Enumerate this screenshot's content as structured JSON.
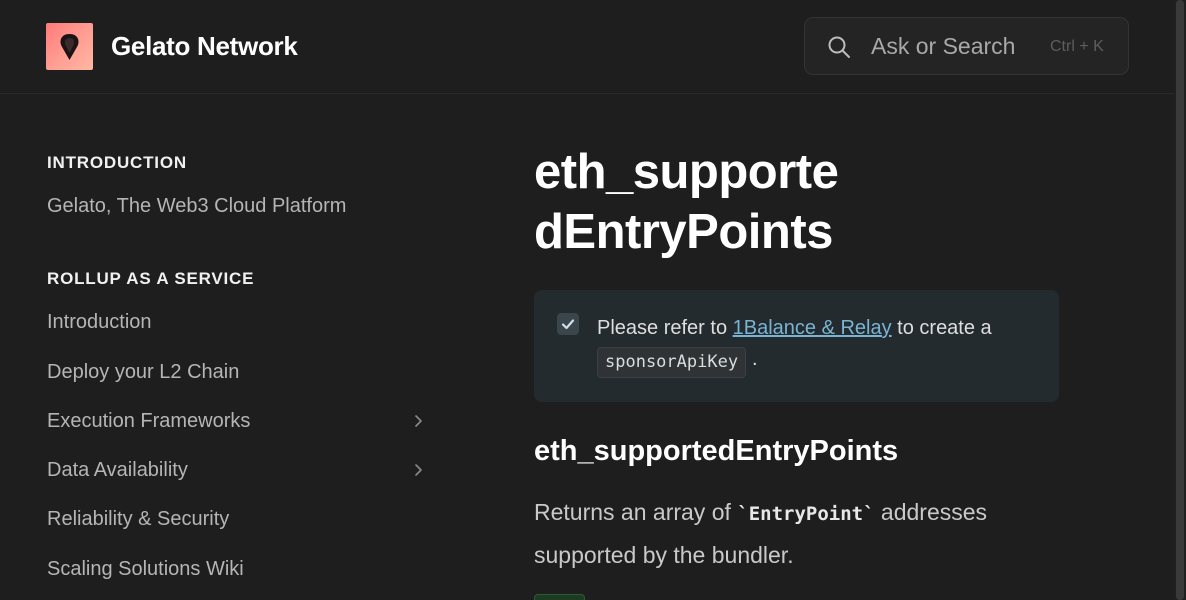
{
  "header": {
    "brand": "Gelato Network",
    "logo_icon": "gelato-logo",
    "search": {
      "placeholder": "Ask or Search",
      "shortcut": "Ctrl + K",
      "icon": "search-icon"
    }
  },
  "sidebar": {
    "sections": [
      {
        "title": "INTRODUCTION",
        "items": [
          {
            "label": "Gelato, The Web3 Cloud Platform"
          }
        ]
      },
      {
        "title": "ROLLUP AS A SERVICE",
        "items": [
          {
            "label": "Introduction"
          },
          {
            "label": "Deploy your L2 Chain"
          },
          {
            "label": "Execution Frameworks",
            "expandable": true
          },
          {
            "label": "Data Availability",
            "expandable": true
          },
          {
            "label": "Reliability & Security"
          },
          {
            "label": "Scaling Solutions Wiki"
          }
        ]
      }
    ]
  },
  "main": {
    "title": "eth_supportedEntryPoints",
    "title_line1": "eth_supporte",
    "title_line2": "dEntryPoints",
    "callout": {
      "icon": "check-icon",
      "prefix": "Please refer to ",
      "link": "1Balance & Relay",
      "suffix": " to create a",
      "code": "sponsorApiKey",
      "end": "."
    },
    "heading": "eth_supportedEntryPoints",
    "paragraph": {
      "before": "Returns an array of ",
      "code": "`EntryPoint`",
      "after": " addresses supported by the bundler."
    }
  },
  "colors": {
    "background": "#1e1e1e",
    "link": "#79b4d4",
    "callout_bg": "#242b2e"
  }
}
